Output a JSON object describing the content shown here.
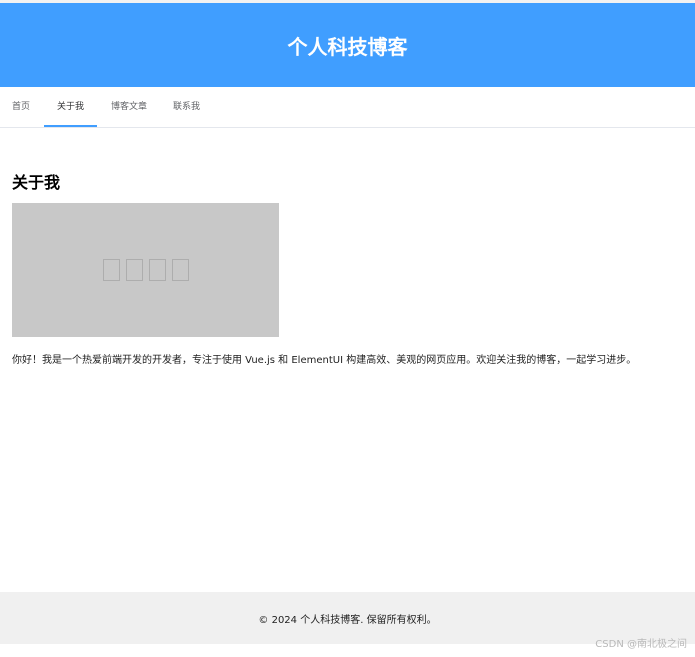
{
  "header": {
    "title": "个人科技博客"
  },
  "nav": {
    "items": [
      {
        "label": "首页"
      },
      {
        "label": "关于我",
        "active": true
      },
      {
        "label": "博客文章"
      },
      {
        "label": "联系我"
      }
    ]
  },
  "main": {
    "section_title": "关于我",
    "intro": "你好！我是一个热爱前端开发的开发者，专注于使用 Vue.js 和 ElementUI 构建高效、美观的网页应用。欢迎关注我的博客，一起学习进步。"
  },
  "footer": {
    "text": "© 2024 个人科技博客. 保留所有权利。"
  },
  "watermark": "CSDN @南北极之间",
  "colors": {
    "header_bg": "#409eff",
    "nav_active_underline": "#409eff",
    "footer_bg": "#f0f0f0",
    "image_placeholder_bg": "#c8c8c8"
  }
}
